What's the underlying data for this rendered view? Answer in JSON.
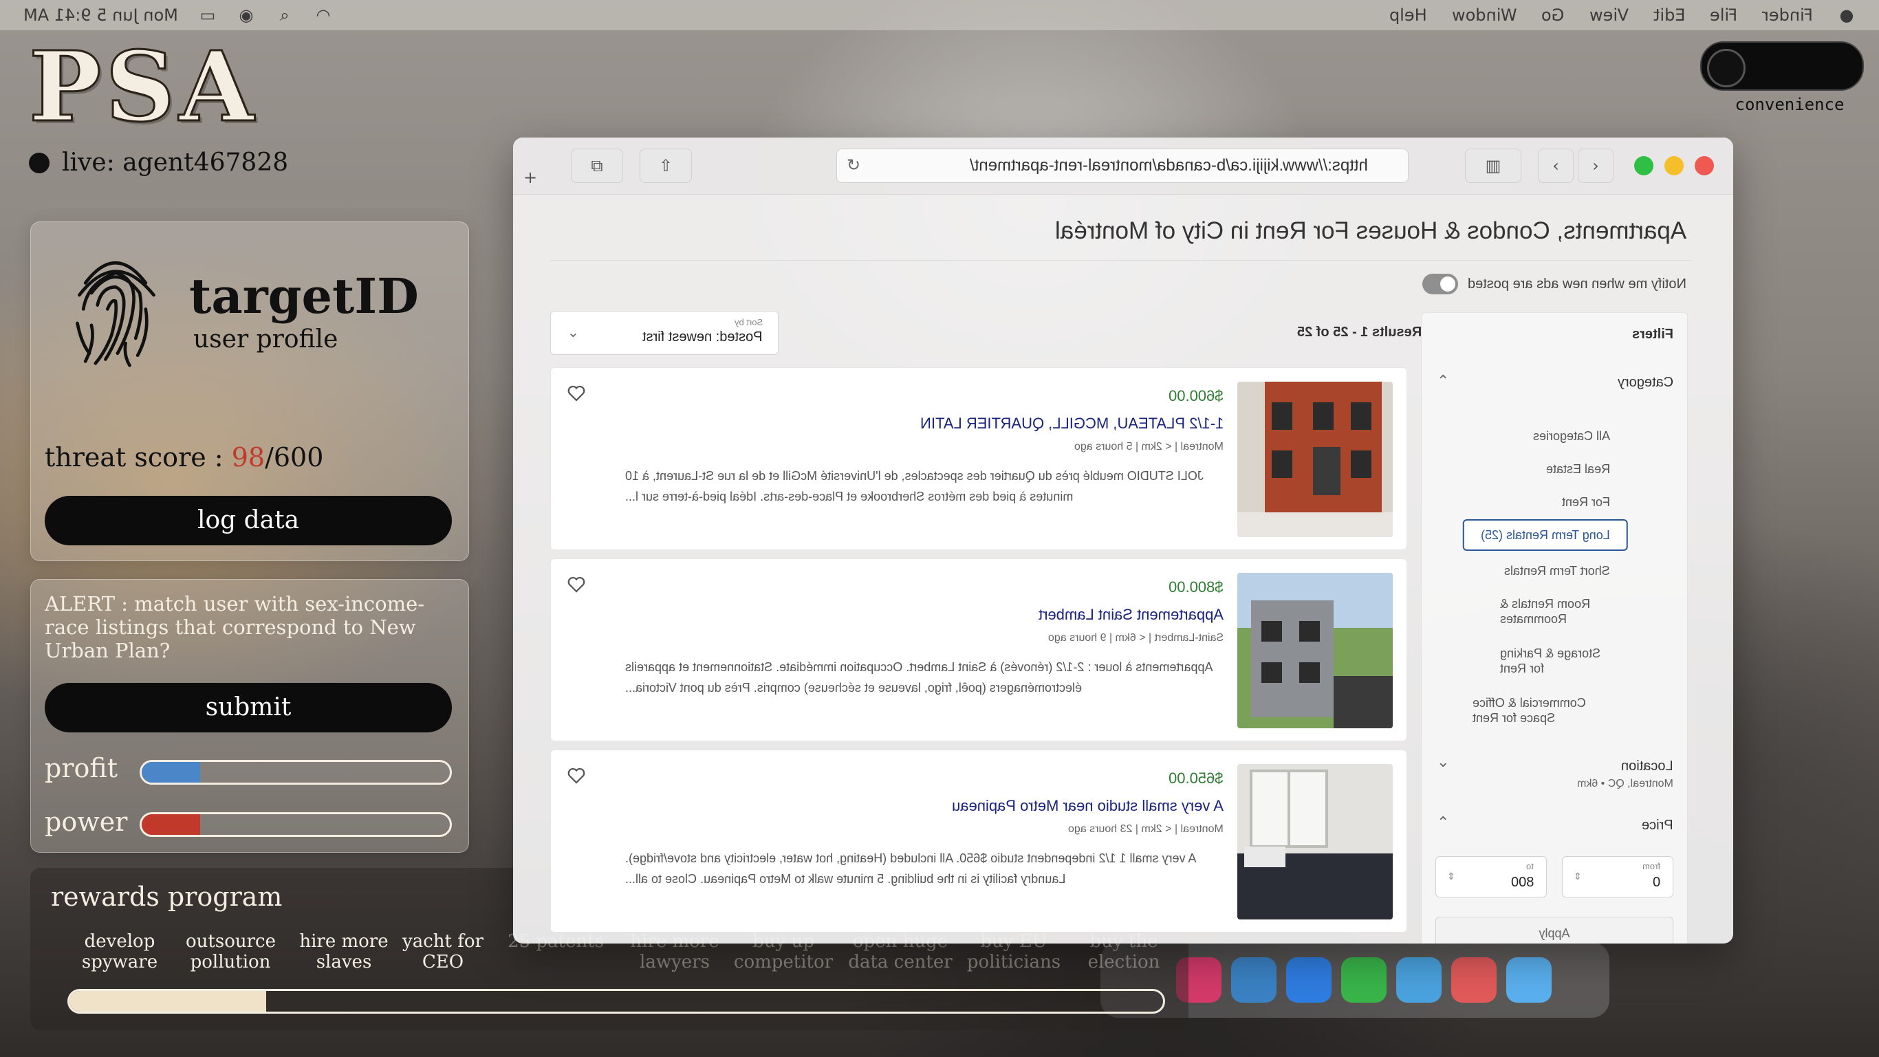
{
  "menubar": {
    "datetime": "Mon Jun 5  9:41 AM",
    "menus": [
      "Finder",
      "File",
      "Edit",
      "View",
      "Go",
      "Window",
      "Help"
    ]
  },
  "logo": "PSA",
  "live_label": "live: agent467828",
  "profile": {
    "title": "targetID",
    "subtitle": "user profile",
    "threat_label": "threat score :",
    "threat_value": "98",
    "threat_max": "/600",
    "log_button": "log data"
  },
  "alert": {
    "text": "ALERT : match user with sex-income-race listings that correspond to New Urban Plan?",
    "submit_button": "submit"
  },
  "meters": {
    "profit_label": "profit",
    "profit_fraction": 0.19,
    "power_label": "power",
    "power_fraction": 0.19
  },
  "colors": {
    "profit": "#4a86c8",
    "power": "#c0392b",
    "threat": "#c0392b",
    "price": "#2e7d32",
    "link": "#1a237e"
  },
  "rewards": {
    "title": "rewards program",
    "items": [
      "develop spyware",
      "outsource pollution",
      "hire more slaves",
      "yacht for CEO",
      "25 patents",
      "hire more lawyers",
      "buy up competitor",
      "open huge data center",
      "buy EU politicians",
      "buy the election"
    ],
    "progress_fraction": 0.18
  },
  "toggle": {
    "label": "convenience"
  },
  "browser": {
    "url": "https://www.kijiji.ca/b-canada/montreal-rent-apartment/",
    "page_title": "Apartments, Condos & Houses For Rent in City of Montréal",
    "notify_label": "Notify me when new ads are posted",
    "filters_title": "Filters",
    "category_label": "Category",
    "categories": [
      "All Categories",
      "Real Estate",
      "For Rent",
      "Long Term Rentals (25)",
      "Short Term Rentals",
      "Room Rentals & Roommates",
      "Storage & Parking for Rent",
      "Commercial & Office Space for Rent"
    ],
    "location_label": "Location",
    "location_value": "Montreal, QC • 6km",
    "price_label": "Price",
    "price_from_label": "from",
    "price_from": "0",
    "price_to_label": "to",
    "price_to": "800",
    "apply_label": "Apply",
    "results_count": "Results 1 - 25 of 25",
    "sort_label": "Sort by",
    "sort_value": "Posted: newest first",
    "listings": [
      {
        "price": "$600.00",
        "title": "1-1/2 PLATEAU, MCGILL, QUARTIER LATIN",
        "meta": "Montreal  |  < 2km  |  5 hours ago",
        "desc": "JOLI STUDIO meublé près du Quartier des spectacles, de l'Université McGill et de la rue St-Laurent, à 10 minutes à pied des métros Sherbrooke et Place-des-arts. Idéal pied-à-terre sur l..."
      },
      {
        "price": "$800.00",
        "title": "Appartement Saint Lambert",
        "meta": "Saint-Lambert  |  < 6km  |  9 hours ago",
        "desc": "Appartements à louer : 2-1/2 (rénovés) à Saint Lambert. Occupation immédiate. Stationnement et appareils électroménagers (poêl, frigo, laveuse et sécheuse) compris. Près du pont Victoria..."
      },
      {
        "price": "$650.00",
        "title": "A very small studio near Metro Papineau",
        "meta": "Montreal  |  < 2km  |  23 hours ago",
        "desc": "A very small 1 1/2 independent studio $650. All included (Heating, hot water, electricity and stove/fridge). Laundry facility is in the building. 5 minute walk to Metro Papineau. Close to all..."
      }
    ]
  }
}
